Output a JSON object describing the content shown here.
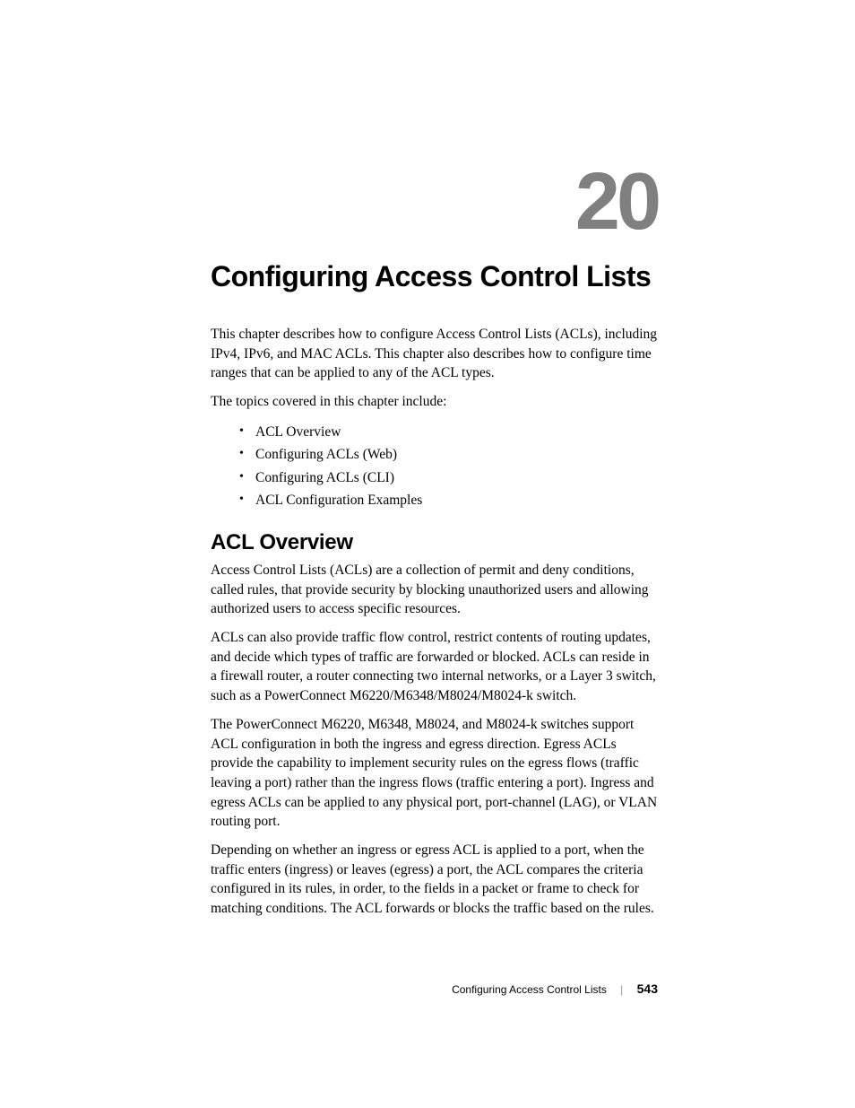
{
  "chapter": {
    "number": "20",
    "title": "Configuring Access Control Lists"
  },
  "intro": {
    "p1": "This chapter describes how to configure Access Control Lists (ACLs), including IPv4, IPv6, and MAC ACLs. This chapter also describes how to configure time ranges that can be applied to any of the ACL types.",
    "p2": "The topics covered in this chapter include:"
  },
  "toc": {
    "items": [
      "ACL Overview",
      "Configuring ACLs (Web)",
      "Configuring ACLs (CLI)",
      "ACL Configuration Examples"
    ]
  },
  "section": {
    "heading": "ACL Overview",
    "p1": "Access Control Lists (ACLs) are a collection of permit and deny conditions, called rules, that provide security by blocking unauthorized users and allowing authorized users to access specific resources.",
    "p2": "ACLs can also provide traffic flow control, restrict contents of routing updates, and decide which types of traffic are forwarded or blocked. ACLs can reside in a firewall router, a router connecting two internal networks, or a Layer 3 switch, such as a PowerConnect M6220/M6348/M8024/M8024-k switch.",
    "p3": "The PowerConnect M6220, M6348, M8024, and M8024-k switches support ACL configuration in both the ingress and egress direction. Egress ACLs provide the capability to implement security rules on the egress flows (traffic leaving a port) rather than the ingress flows (traffic entering a port). Ingress and egress ACLs can be applied to any physical port, port-channel (LAG), or VLAN routing port.",
    "p4": "Depending on whether an ingress or egress ACL is applied to a port, when the traffic enters (ingress) or leaves (egress) a port, the ACL compares the criteria configured in its rules, in order, to the fields in a packet or frame to check for matching conditions. The ACL forwards or blocks the traffic based on the rules."
  },
  "footer": {
    "title": "Configuring Access Control Lists",
    "page": "543"
  }
}
